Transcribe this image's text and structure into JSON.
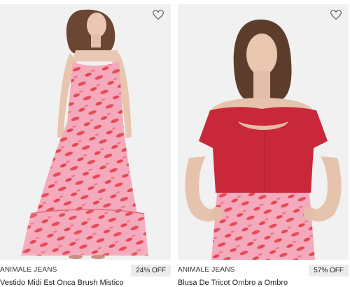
{
  "products": [
    {
      "brand": "ANIMALE JEANS",
      "discount": "24% OFF",
      "name": "Vestido Midi Est Onca Brush Mistico",
      "favorite_icon": "heart-outline-icon"
    },
    {
      "brand": "ANIMALE JEANS",
      "discount": "57% OFF",
      "name": "Blusa De Tricot Ombro a Ombro",
      "favorite_icon": "heart-outline-icon"
    }
  ],
  "colors": {
    "photo_background": "#f1f1f1",
    "print_pink": "#f2a3b6",
    "print_red": "#e2454f",
    "knit_red": "#c8283a",
    "badge_background": "#ececec"
  }
}
